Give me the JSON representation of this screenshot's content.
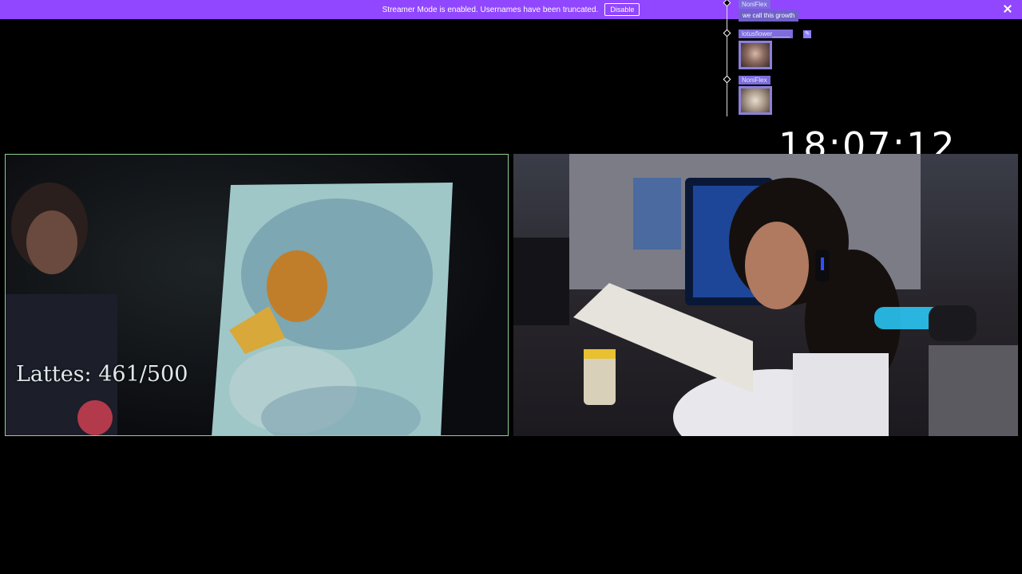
{
  "banner": {
    "message": "Streamer Mode is enabled. Usernames have been truncated.",
    "disable_label": "Disable",
    "color": "#9147ff"
  },
  "chat": {
    "items": [
      {
        "username": "NoniFlex",
        "message": "we call this growth"
      },
      {
        "username": "lotusflower_____",
        "has_image": true
      },
      {
        "username": "NoniFlex",
        "has_image": true
      }
    ]
  },
  "clock": {
    "time": "18:07:12"
  },
  "overlay": {
    "lattes": "Lattes: 461/500"
  },
  "icons": {
    "close": "close-icon",
    "edit": "pencil-icon",
    "timeline": "diamond-icon"
  }
}
